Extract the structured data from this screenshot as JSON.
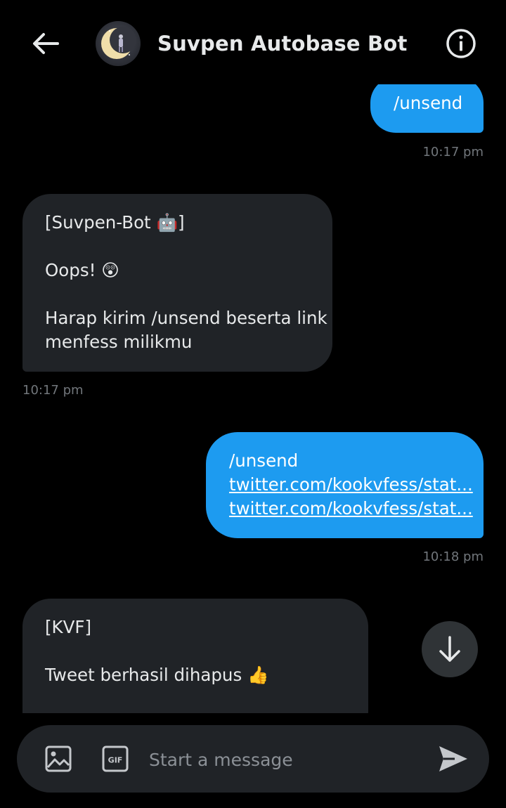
{
  "header": {
    "title": "Suvpen Autobase Bot",
    "icons": {
      "back": "arrow-left-icon",
      "info": "info-icon",
      "avatar": "moon-avatar"
    }
  },
  "messages": [
    {
      "direction": "outgoing",
      "lines": [
        "/unsend"
      ],
      "time": "10:17 pm"
    },
    {
      "direction": "incoming",
      "lines": [
        "[Suvpen-Bot 🤖]",
        "",
        "Oops! 😲",
        "",
        "Harap kirim /unsend beserta link",
        "menfess milikmu"
      ],
      "time": "10:17 pm"
    },
    {
      "direction": "outgoing",
      "lines": [
        "/unsend"
      ],
      "links": [
        "twitter.com/kookvfess/stat...",
        "twitter.com/kookvfess/stat..."
      ],
      "time": "10:18 pm"
    },
    {
      "direction": "incoming",
      "lines": [
        "[KVF]",
        "",
        "Tweet berhasil dihapus 👍"
      ]
    }
  ],
  "composer": {
    "placeholder": "Start a message"
  },
  "colors": {
    "background": "#000000",
    "outgoing_bubble": "#1d9bf0",
    "incoming_bubble": "#202327",
    "timestamp": "#71767b"
  }
}
